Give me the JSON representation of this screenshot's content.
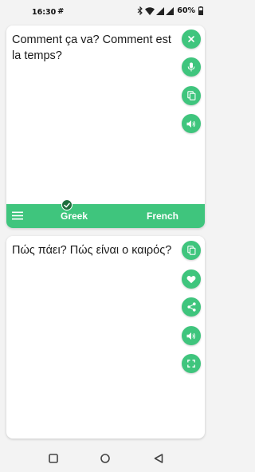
{
  "status_bar": {
    "time": "16:30",
    "hash_symbol": "#",
    "battery": "60%"
  },
  "source_panel": {
    "text": "Comment ça va? Comment est la temps?",
    "buttons": [
      "close-icon",
      "mic-icon",
      "copy-icon",
      "speaker-icon"
    ]
  },
  "language_bar": {
    "source_language": "Greek",
    "target_language": "French"
  },
  "target_panel": {
    "text": "Πώς πάει? Πώς είναι ο καιρός?",
    "buttons": [
      "copy-icon",
      "heart-icon",
      "share-icon",
      "speaker-icon",
      "fullscreen-icon"
    ]
  },
  "nav_bar": {
    "buttons": [
      "recents-square-icon",
      "home-circle-icon",
      "back-triangle-icon"
    ]
  },
  "colors": {
    "accent": "#3fc57d",
    "check_badge": "#1f6e3d",
    "background": "#f3f3f3"
  }
}
